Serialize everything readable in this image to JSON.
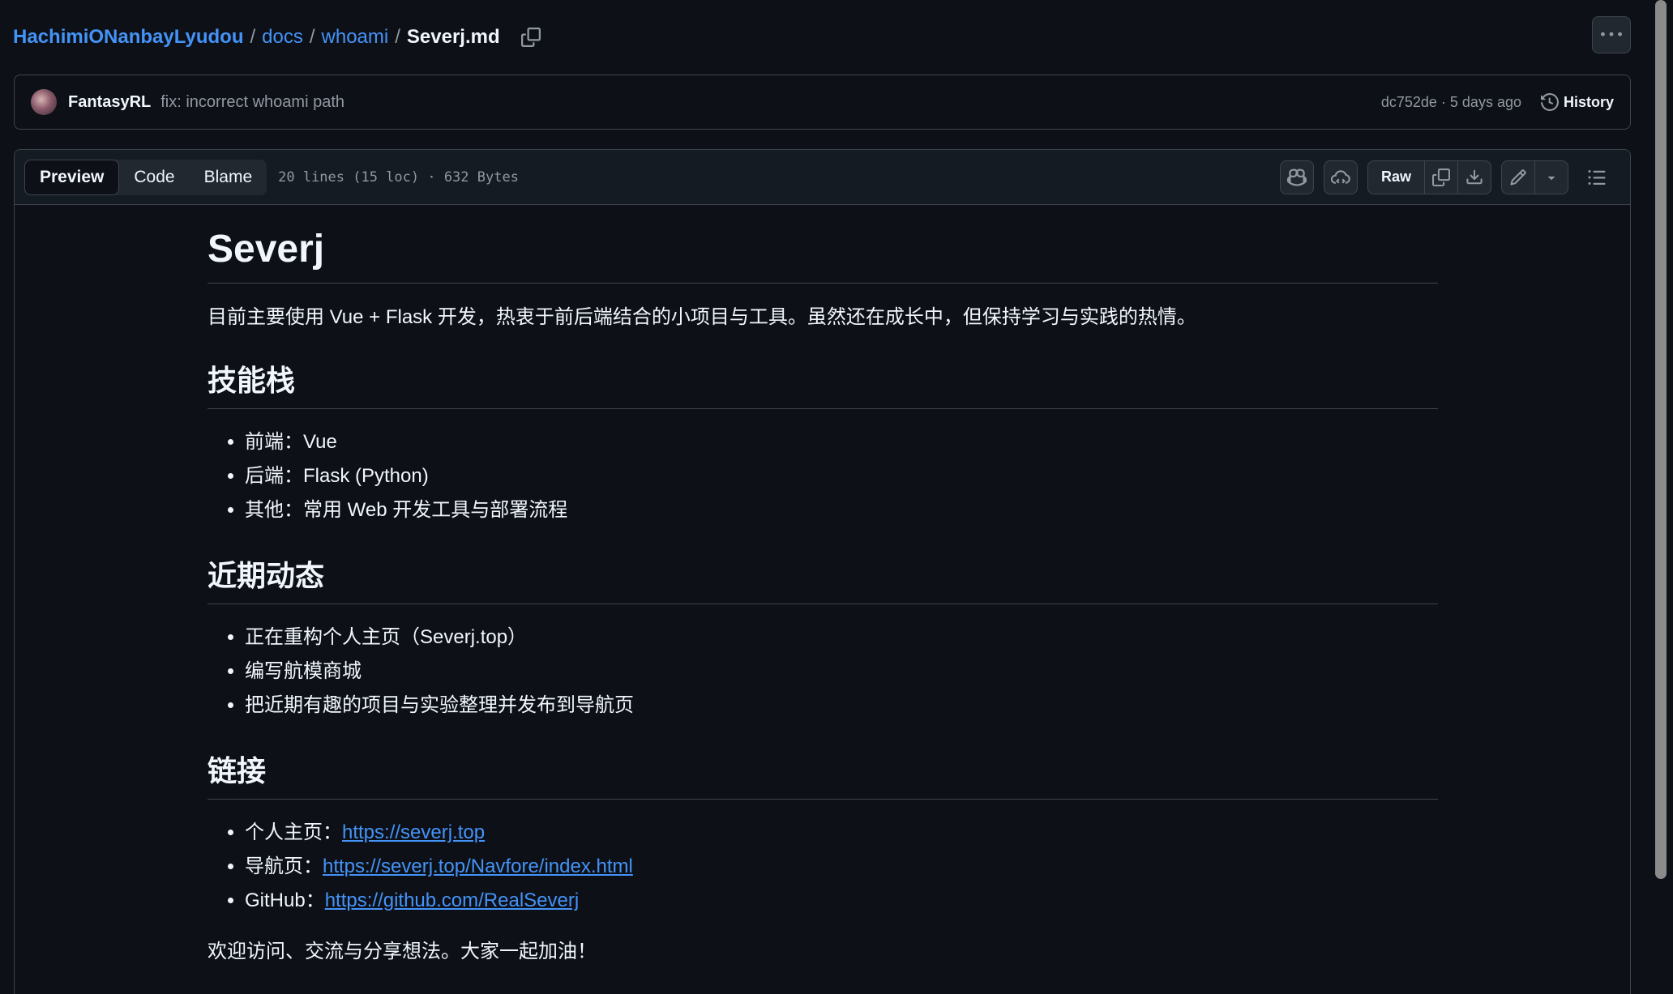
{
  "breadcrumb": {
    "repo": "HachimiONanbayLyudou",
    "sep": "/",
    "dirs": [
      "docs",
      "whoami"
    ],
    "file": "Severj.md"
  },
  "commit": {
    "author": "FantasyRL",
    "message": "fix: incorrect whoami path",
    "meta": "dc752de · 5 days ago",
    "history_label": "History"
  },
  "file_header": {
    "tabs": [
      {
        "label": "Preview",
        "active": true
      },
      {
        "label": "Code",
        "active": false
      },
      {
        "label": "Blame",
        "active": false
      }
    ],
    "info": "20 lines (15 loc) · 632 Bytes",
    "raw_label": "Raw"
  },
  "markdown": {
    "title": "Severj",
    "intro": "目前主要使用 Vue + Flask 开发，热衷于前后端结合的小项目与工具。虽然还在成长中，但保持学习与实践的热情。",
    "sections": [
      {
        "heading": "技能栈",
        "items": [
          "前端：Vue",
          "后端：Flask (Python)",
          "其他：常用 Web 开发工具与部署流程"
        ]
      },
      {
        "heading": "近期动态",
        "items": [
          "正在重构个人主页（Severj.top）",
          "编写航模商城",
          "把近期有趣的项目与实验整理并发布到导航页"
        ]
      },
      {
        "heading": "链接",
        "links": [
          {
            "label": "个人主页：",
            "url": "https://severj.top"
          },
          {
            "label": "导航页：",
            "url": "https://severj.top/Navfore/index.html"
          },
          {
            "label": "GitHub：",
            "url": "https://github.com/RealSeverj"
          }
        ]
      }
    ],
    "outro": "欢迎访问、交流与分享想法。大家一起加油！"
  },
  "colors": {
    "background": "#0d1117",
    "link": "#4493f8",
    "border": "#3d444d",
    "muted": "#9198a1"
  },
  "icons": [
    "copy-icon",
    "kebab-icon",
    "history-icon",
    "copilot-icon",
    "cloud-icon",
    "copy-raw-icon",
    "download-icon",
    "pencil-icon",
    "chevron-down-icon",
    "list-icon"
  ]
}
